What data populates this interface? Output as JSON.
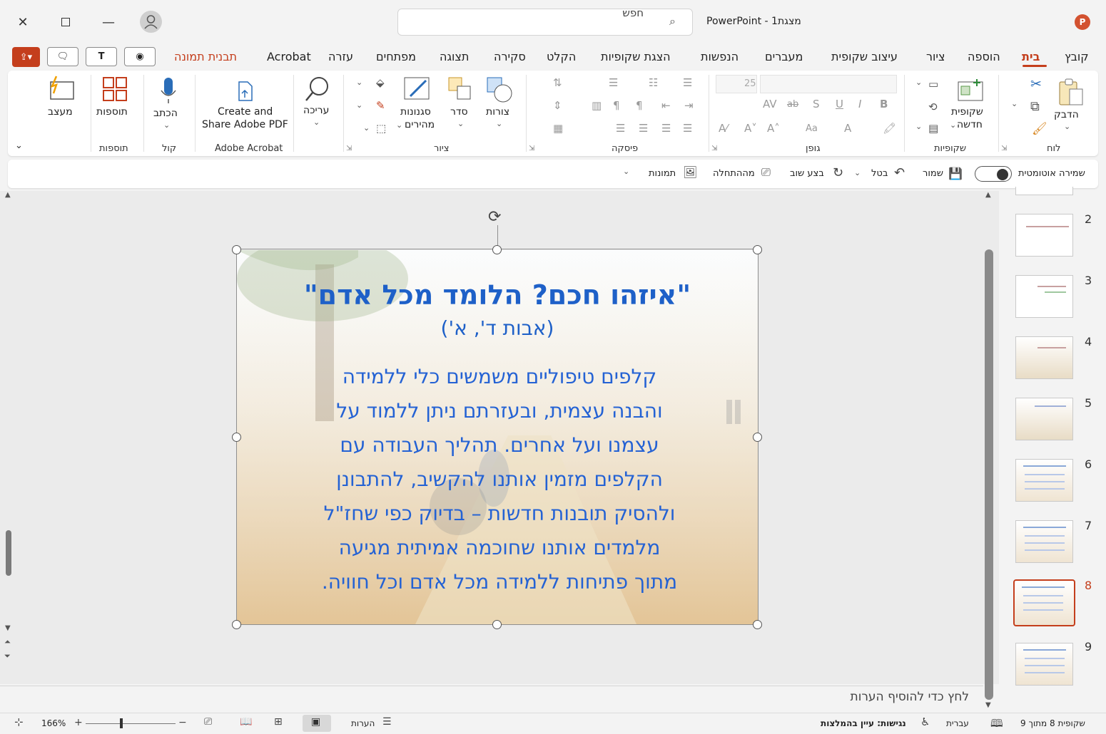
{
  "window": {
    "app_title": "PowerPoint  -  מצגת1",
    "search_placeholder": "חפש",
    "logo_letter": "P"
  },
  "tabs": [
    "קובץ",
    "בית",
    "הוספה",
    "ציור",
    "עיצוב שקופית",
    "מעברים",
    "הנפשות",
    "הצגת שקופיות",
    "הקלט",
    "סקירה",
    "תצוגה",
    "מפתחים",
    "עזרה",
    "Acrobat",
    "תבנית תמונה"
  ],
  "active_tab": "בית",
  "ribbon": {
    "clipboard": {
      "paste": "הדבק",
      "group": "לוח"
    },
    "slides": {
      "new_slide_l1": "שקופית",
      "new_slide_l2": "חדשה",
      "group": "שקופיות"
    },
    "font": {
      "group": "גופן",
      "size": "25"
    },
    "paragraph": {
      "group": "פיסקה"
    },
    "drawing": {
      "shapes": "צורות",
      "arrange": "סדר",
      "quick_styles_l1": "סגנונות",
      "quick_styles_l2": "מהירים",
      "group": "ציור"
    },
    "editing": {
      "label": "עריכה"
    },
    "acrobat": {
      "l1": "Create and",
      "l2": "Share Adobe PDF",
      "group": "Adobe Acrobat"
    },
    "voice": {
      "dictate": "הכתב",
      "group": "קול"
    },
    "addins": {
      "label": "תוספות",
      "group": "תוספות"
    },
    "designer": {
      "label": "מעצב"
    }
  },
  "qat": {
    "autosave": "שמירה אוטומטית",
    "save": "שמור",
    "undo": "בטל",
    "redo": "בצע שוב",
    "from_start": "מההתחלה",
    "pictures": "תמונות"
  },
  "slide": {
    "title": "\"איזהו חכם? הלומד מכל אדם\"",
    "subtitle": "(אבות ד', א')",
    "body": [
      "קלפים טיפוליים משמשים כלי ללמידה",
      "והבנה עצמית, ובעזרתם ניתן ללמוד על",
      "עצמנו ועל אחרים. תהליך העבודה עם",
      "הקלפים מזמין אותנו להקשיב, להתבונן",
      "ולהסיק תובנות חדשות – בדיוק כפי שחז\"ל",
      "מלמדים אותנו שחוכמה אמיתית מגיעה",
      "מתוך פתיחות ללמידה מכל אדם וכל חוויה."
    ]
  },
  "notes": {
    "placeholder": "לחץ כדי להוסיף הערות"
  },
  "thumbnails": {
    "numbers": [
      "2",
      "3",
      "4",
      "5",
      "6",
      "7",
      "8",
      "9"
    ],
    "selected": "8"
  },
  "status": {
    "slide_of": "שקופית 8 מתוך 9",
    "language": "עברית",
    "accessibility": "נגישות: עיין בהמלצות",
    "notes": "הערות",
    "zoom": "166%"
  },
  "colors": {
    "accent": "#c43e1c",
    "slide_text": "#1e60c8"
  },
  "icons": [
    "close-icon",
    "maximize-icon",
    "minimize-icon",
    "account-icon",
    "search-icon",
    "share-icon",
    "comments-icon",
    "teams-icon",
    "record-icon",
    "paste-icon",
    "cut-icon",
    "copy-icon",
    "format-painter-icon",
    "new-slide-icon",
    "shapes-icon",
    "arrange-icon",
    "quick-styles-icon",
    "find-icon",
    "pdf-icon",
    "microphone-icon",
    "addins-icon",
    "designer-icon",
    "save-icon",
    "undo-icon",
    "redo-icon",
    "slideshow-icon",
    "pictures-icon",
    "rotate-handle-icon"
  ]
}
